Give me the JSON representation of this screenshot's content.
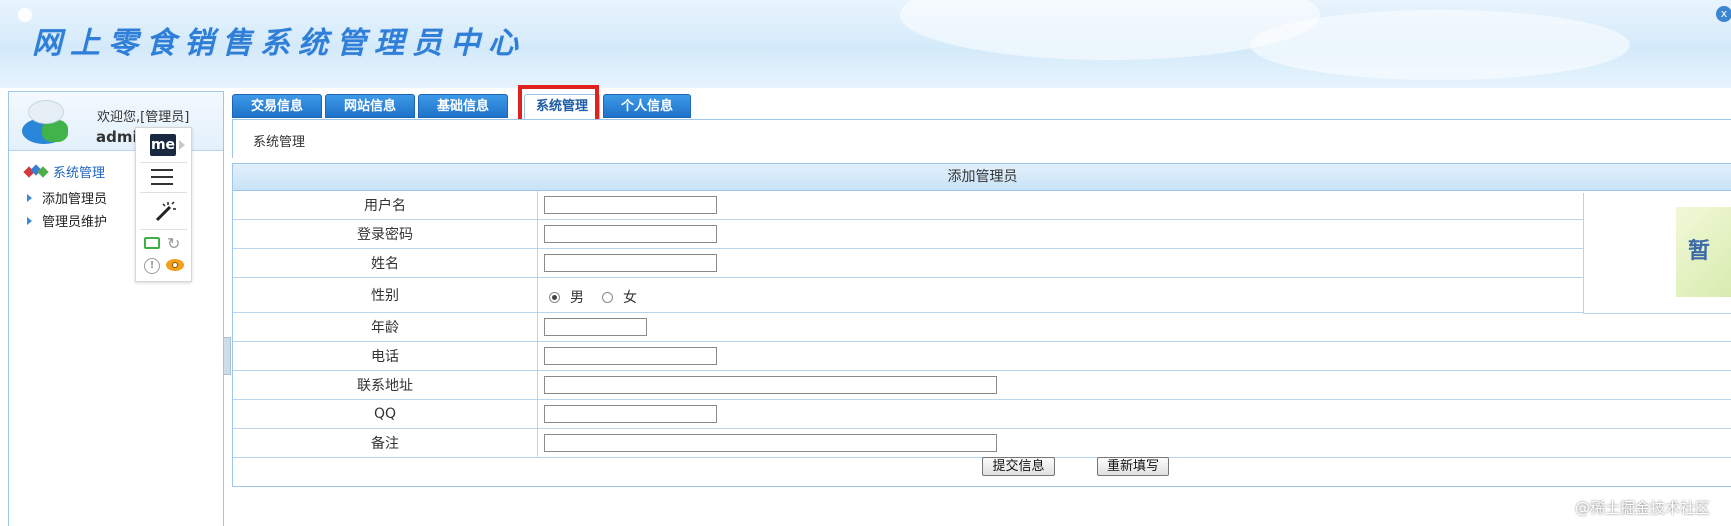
{
  "app": {
    "title": "网上零食销售系统管理员中心"
  },
  "user": {
    "welcome": "欢迎您,[管理员]",
    "name": "admin"
  },
  "sidebar": {
    "header": "系统管理",
    "items": [
      {
        "label": "添加管理员"
      },
      {
        "label": "管理员维护"
      }
    ]
  },
  "toolbar_ext": {
    "brand": "me"
  },
  "tabs": [
    {
      "label": "交易信息"
    },
    {
      "label": "网站信息"
    },
    {
      "label": "基础信息"
    },
    {
      "label": "系统管理",
      "active": true
    },
    {
      "label": "个人信息"
    }
  ],
  "breadcrumb": "系统管理",
  "form": {
    "title": "添加管理员",
    "fields": [
      {
        "label": "用户名",
        "value": ""
      },
      {
        "label": "登录密码",
        "value": ""
      },
      {
        "label": "姓名",
        "value": ""
      },
      {
        "label": "性别",
        "options": [
          "男",
          "女"
        ],
        "selected": "男"
      },
      {
        "label": "年龄",
        "value": ""
      },
      {
        "label": "电话",
        "value": ""
      },
      {
        "label": "联系地址",
        "value": ""
      },
      {
        "label": "QQ",
        "value": ""
      },
      {
        "label": "备注",
        "value": ""
      }
    ],
    "photo_text": "暂",
    "submit_label": "提交信息",
    "reset_label": "重新填写"
  },
  "watermark": "@稀土掘金技术社区",
  "colors": {
    "tab_blue": "#2a82d6",
    "highlight_red": "#e0211d",
    "border_blue": "#9fc6e8"
  }
}
